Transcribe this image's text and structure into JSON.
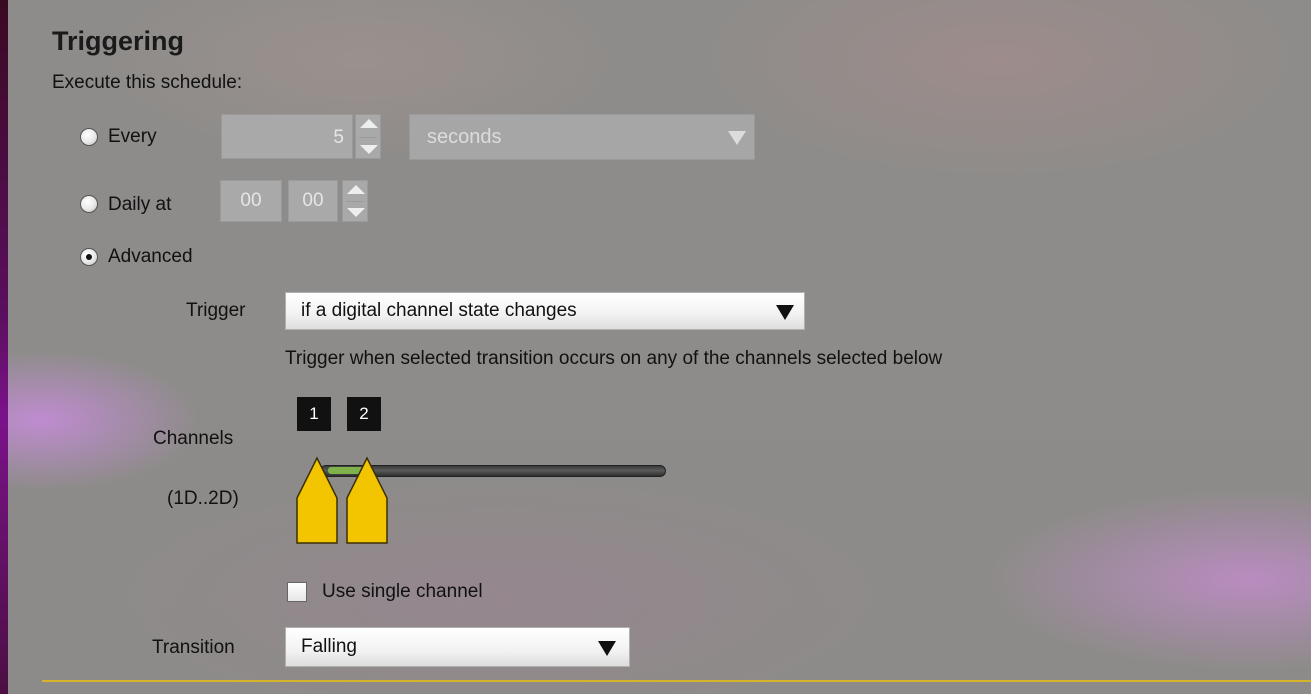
{
  "section": {
    "title": "Triggering",
    "subtitle": "Execute this schedule:"
  },
  "schedule": {
    "every": {
      "label": "Every",
      "value": "5",
      "unit": "seconds",
      "selected": false
    },
    "daily": {
      "label": "Daily at",
      "hour": "00",
      "minute": "00",
      "selected": false
    },
    "advanced": {
      "label": "Advanced",
      "selected": true
    }
  },
  "trigger": {
    "label": "Trigger",
    "value": "if a digital channel state changes",
    "description": "Trigger when selected transition occurs on any of the channels selected below"
  },
  "channels": {
    "label": "Channels",
    "range_label": "(1D..2D)",
    "badges": [
      "1",
      "2"
    ],
    "single_channel_label": "Use single channel",
    "single_channel_checked": false
  },
  "transition": {
    "label": "Transition",
    "value": "Falling"
  },
  "colors": {
    "accent_line": "#d6b42a",
    "slider_handle": "#f2c500",
    "slider_range": "#7fb24a"
  }
}
